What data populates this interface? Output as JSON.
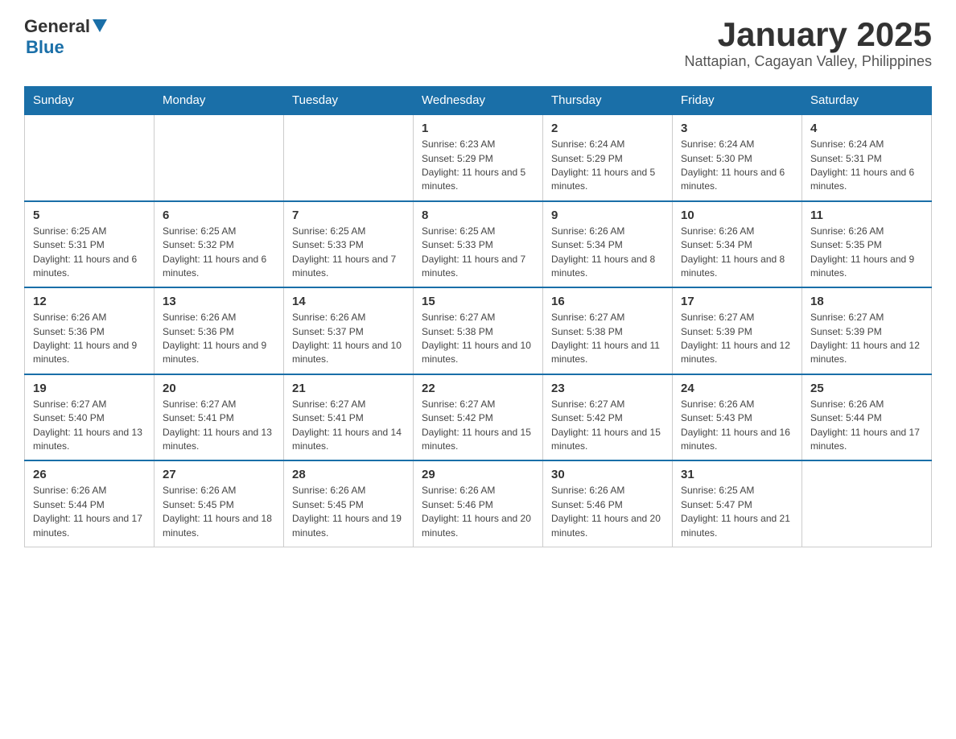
{
  "header": {
    "logo": {
      "general": "General",
      "blue": "Blue"
    },
    "title": "January 2025",
    "subtitle": "Nattapian, Cagayan Valley, Philippines"
  },
  "days_of_week": [
    "Sunday",
    "Monday",
    "Tuesday",
    "Wednesday",
    "Thursday",
    "Friday",
    "Saturday"
  ],
  "weeks": [
    [
      {
        "day": "",
        "info": ""
      },
      {
        "day": "",
        "info": ""
      },
      {
        "day": "",
        "info": ""
      },
      {
        "day": "1",
        "info": "Sunrise: 6:23 AM\nSunset: 5:29 PM\nDaylight: 11 hours and 5 minutes."
      },
      {
        "day": "2",
        "info": "Sunrise: 6:24 AM\nSunset: 5:29 PM\nDaylight: 11 hours and 5 minutes."
      },
      {
        "day": "3",
        "info": "Sunrise: 6:24 AM\nSunset: 5:30 PM\nDaylight: 11 hours and 6 minutes."
      },
      {
        "day": "4",
        "info": "Sunrise: 6:24 AM\nSunset: 5:31 PM\nDaylight: 11 hours and 6 minutes."
      }
    ],
    [
      {
        "day": "5",
        "info": "Sunrise: 6:25 AM\nSunset: 5:31 PM\nDaylight: 11 hours and 6 minutes."
      },
      {
        "day": "6",
        "info": "Sunrise: 6:25 AM\nSunset: 5:32 PM\nDaylight: 11 hours and 6 minutes."
      },
      {
        "day": "7",
        "info": "Sunrise: 6:25 AM\nSunset: 5:33 PM\nDaylight: 11 hours and 7 minutes."
      },
      {
        "day": "8",
        "info": "Sunrise: 6:25 AM\nSunset: 5:33 PM\nDaylight: 11 hours and 7 minutes."
      },
      {
        "day": "9",
        "info": "Sunrise: 6:26 AM\nSunset: 5:34 PM\nDaylight: 11 hours and 8 minutes."
      },
      {
        "day": "10",
        "info": "Sunrise: 6:26 AM\nSunset: 5:34 PM\nDaylight: 11 hours and 8 minutes."
      },
      {
        "day": "11",
        "info": "Sunrise: 6:26 AM\nSunset: 5:35 PM\nDaylight: 11 hours and 9 minutes."
      }
    ],
    [
      {
        "day": "12",
        "info": "Sunrise: 6:26 AM\nSunset: 5:36 PM\nDaylight: 11 hours and 9 minutes."
      },
      {
        "day": "13",
        "info": "Sunrise: 6:26 AM\nSunset: 5:36 PM\nDaylight: 11 hours and 9 minutes."
      },
      {
        "day": "14",
        "info": "Sunrise: 6:26 AM\nSunset: 5:37 PM\nDaylight: 11 hours and 10 minutes."
      },
      {
        "day": "15",
        "info": "Sunrise: 6:27 AM\nSunset: 5:38 PM\nDaylight: 11 hours and 10 minutes."
      },
      {
        "day": "16",
        "info": "Sunrise: 6:27 AM\nSunset: 5:38 PM\nDaylight: 11 hours and 11 minutes."
      },
      {
        "day": "17",
        "info": "Sunrise: 6:27 AM\nSunset: 5:39 PM\nDaylight: 11 hours and 12 minutes."
      },
      {
        "day": "18",
        "info": "Sunrise: 6:27 AM\nSunset: 5:39 PM\nDaylight: 11 hours and 12 minutes."
      }
    ],
    [
      {
        "day": "19",
        "info": "Sunrise: 6:27 AM\nSunset: 5:40 PM\nDaylight: 11 hours and 13 minutes."
      },
      {
        "day": "20",
        "info": "Sunrise: 6:27 AM\nSunset: 5:41 PM\nDaylight: 11 hours and 13 minutes."
      },
      {
        "day": "21",
        "info": "Sunrise: 6:27 AM\nSunset: 5:41 PM\nDaylight: 11 hours and 14 minutes."
      },
      {
        "day": "22",
        "info": "Sunrise: 6:27 AM\nSunset: 5:42 PM\nDaylight: 11 hours and 15 minutes."
      },
      {
        "day": "23",
        "info": "Sunrise: 6:27 AM\nSunset: 5:42 PM\nDaylight: 11 hours and 15 minutes."
      },
      {
        "day": "24",
        "info": "Sunrise: 6:26 AM\nSunset: 5:43 PM\nDaylight: 11 hours and 16 minutes."
      },
      {
        "day": "25",
        "info": "Sunrise: 6:26 AM\nSunset: 5:44 PM\nDaylight: 11 hours and 17 minutes."
      }
    ],
    [
      {
        "day": "26",
        "info": "Sunrise: 6:26 AM\nSunset: 5:44 PM\nDaylight: 11 hours and 17 minutes."
      },
      {
        "day": "27",
        "info": "Sunrise: 6:26 AM\nSunset: 5:45 PM\nDaylight: 11 hours and 18 minutes."
      },
      {
        "day": "28",
        "info": "Sunrise: 6:26 AM\nSunset: 5:45 PM\nDaylight: 11 hours and 19 minutes."
      },
      {
        "day": "29",
        "info": "Sunrise: 6:26 AM\nSunset: 5:46 PM\nDaylight: 11 hours and 20 minutes."
      },
      {
        "day": "30",
        "info": "Sunrise: 6:26 AM\nSunset: 5:46 PM\nDaylight: 11 hours and 20 minutes."
      },
      {
        "day": "31",
        "info": "Sunrise: 6:25 AM\nSunset: 5:47 PM\nDaylight: 11 hours and 21 minutes."
      },
      {
        "day": "",
        "info": ""
      }
    ]
  ]
}
